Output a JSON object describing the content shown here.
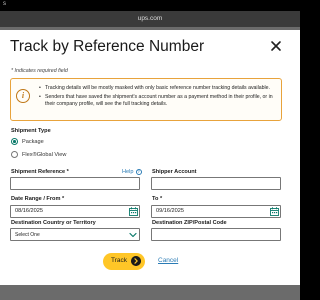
{
  "status_bar": {
    "time": "s"
  },
  "browser": {
    "url": "ups.com"
  },
  "modal": {
    "title": "Track by Reference Number",
    "required_note": "* Indicates required field",
    "info": {
      "icon": "info-icon",
      "bullets": [
        "Tracking details will be mostly masked with only basic reference number tracking details available.",
        "Senders that have saved the shipment's account number as a payment method in their profile, or in their company profile, will see the full tracking details."
      ]
    },
    "shipment_type": {
      "label": "Shipment Type",
      "options": [
        {
          "label": "Package",
          "selected": true
        },
        {
          "label": "Flex®Global View",
          "selected": false
        }
      ]
    },
    "shipment_reference": {
      "label": "Shipment Reference *",
      "value": "",
      "help": "Help"
    },
    "shipper_account": {
      "label": "Shipper Account",
      "value": ""
    },
    "date_from": {
      "label": "Date Range / From *",
      "value": "08/16/2025"
    },
    "date_to": {
      "label": "To *",
      "value": "09/16/2025"
    },
    "destination_country": {
      "label": "Destination Country or Territory",
      "value": "Select One"
    },
    "destination_zip": {
      "label": "Destination ZIP/Postal Code",
      "value": ""
    },
    "actions": {
      "track": "Track",
      "cancel": "Cancel"
    }
  },
  "colors": {
    "accent_yellow": "#ffc627",
    "link_blue": "#2a7bb5",
    "radio_green": "#0a7a6a",
    "info_border": "#e8a33c"
  }
}
